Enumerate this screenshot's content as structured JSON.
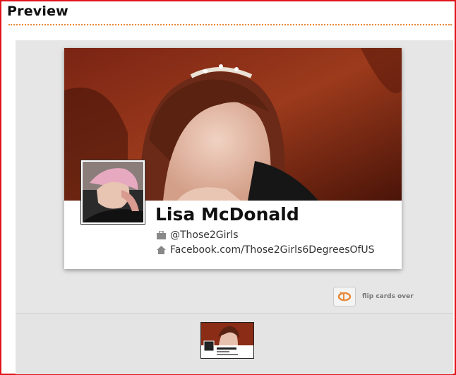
{
  "panel": {
    "title": "Preview"
  },
  "card": {
    "name": "Lisa McDonald",
    "company": "@Those2Girls",
    "website": "Facebook.com/Those2Girls6DegreesOfUS",
    "company_icon": "briefcase-icon",
    "website_icon": "home-icon"
  },
  "controls": {
    "flip_label": "flip cards over",
    "flip_icon": "rotate-arrow-icon"
  },
  "colors": {
    "border": "#e0141b",
    "accent": "#e8893a",
    "stage": "#e6e6e6"
  }
}
